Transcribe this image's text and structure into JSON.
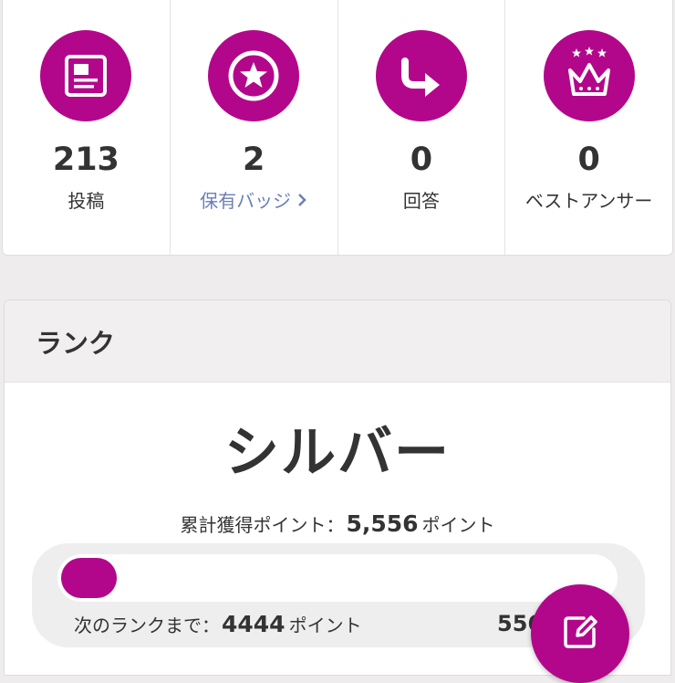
{
  "colors": {
    "accent": "#b3078b",
    "link": "#6b7eb6",
    "text": "#333333",
    "header_bg": "#f1efef"
  },
  "stats": [
    {
      "icon": "document-icon",
      "count": "213",
      "label": "投稿",
      "is_link": false
    },
    {
      "icon": "star-badge-icon",
      "count": "2",
      "label": "保有バッジ",
      "is_link": true
    },
    {
      "icon": "reply-arrow-icon",
      "count": "0",
      "label": "回答",
      "is_link": false
    },
    {
      "icon": "crown-icon",
      "count": "0",
      "label": "ベストアンサー",
      "is_link": false
    }
  ],
  "rank": {
    "header": "ランク",
    "name": "シルバー",
    "total_label": "累計獲得ポイント：",
    "total_value": "5,556",
    "points_unit": "ポイント",
    "next_label": "次のランクまで：",
    "next_value": "4444",
    "progress_right": "556",
    "progress_fraction": 0.1
  },
  "fab": {
    "icon": "edit-icon"
  }
}
